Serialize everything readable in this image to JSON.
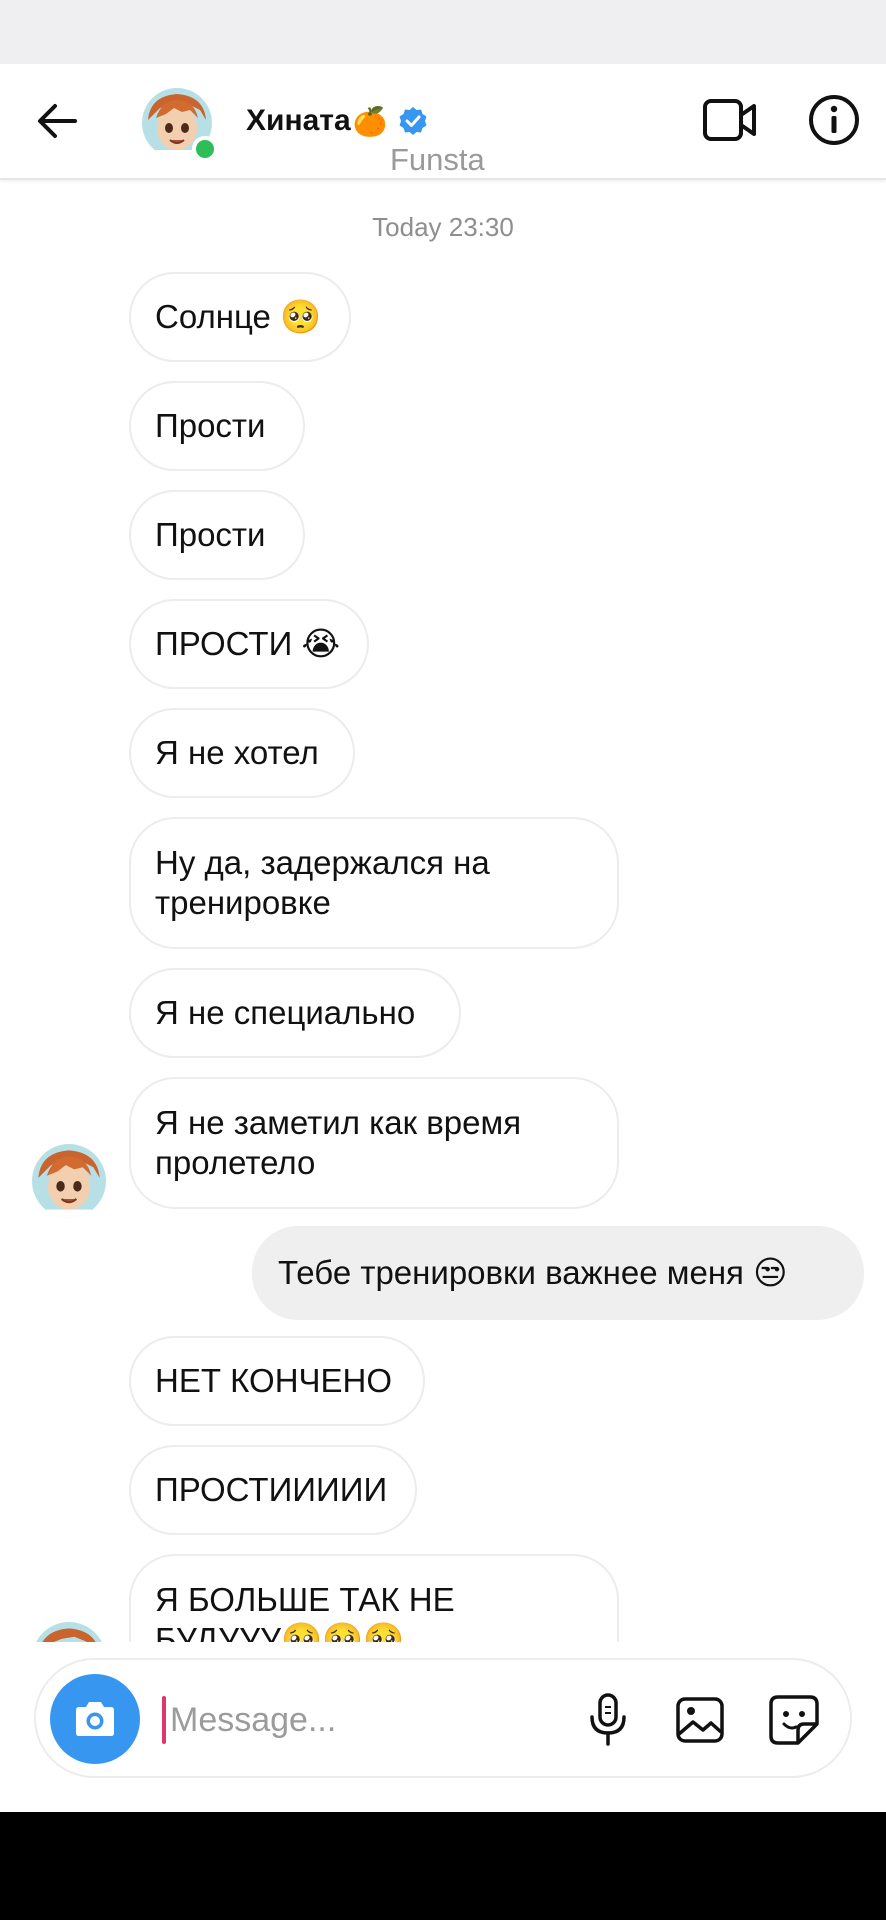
{
  "header": {
    "name": "Хината",
    "name_emoji": "🍊",
    "subtitle": "Funsta",
    "online_color": "#2ebd59",
    "verified_color": "#3797f0"
  },
  "timestamp": "Today 23:30",
  "messages": [
    {
      "side": "in",
      "text": "Солнце 🥺"
    },
    {
      "side": "in",
      "text": "Прости"
    },
    {
      "side": "in",
      "text": "Прости"
    },
    {
      "side": "in",
      "text": "ПРОСТИ 😭"
    },
    {
      "side": "in",
      "text": "Я не хотел"
    },
    {
      "side": "in",
      "text": "Ну да, задержался на\nтренировке"
    },
    {
      "side": "in",
      "text": "Я не специально"
    },
    {
      "side": "in",
      "text": "Я не заметил как время\nпролетело"
    },
    {
      "side": "out",
      "text": "Тебе тренировки важнее меня 😒"
    },
    {
      "side": "in",
      "text": "НЕТ КОНЧЕНО"
    },
    {
      "side": "in",
      "text": "ПРОСТИИИИИ"
    },
    {
      "side": "in",
      "text": "Я БОЛЬШЕ ТАК НЕ\nБУДУУУ🥺🥺🥺"
    }
  ],
  "composer": {
    "placeholder": "Message...",
    "accent": "#3797f0"
  },
  "icons": [
    "back-arrow-icon",
    "verified-badge-icon",
    "video-call-icon",
    "info-icon",
    "camera-icon",
    "microphone-icon",
    "gallery-icon",
    "sticker-icon"
  ]
}
